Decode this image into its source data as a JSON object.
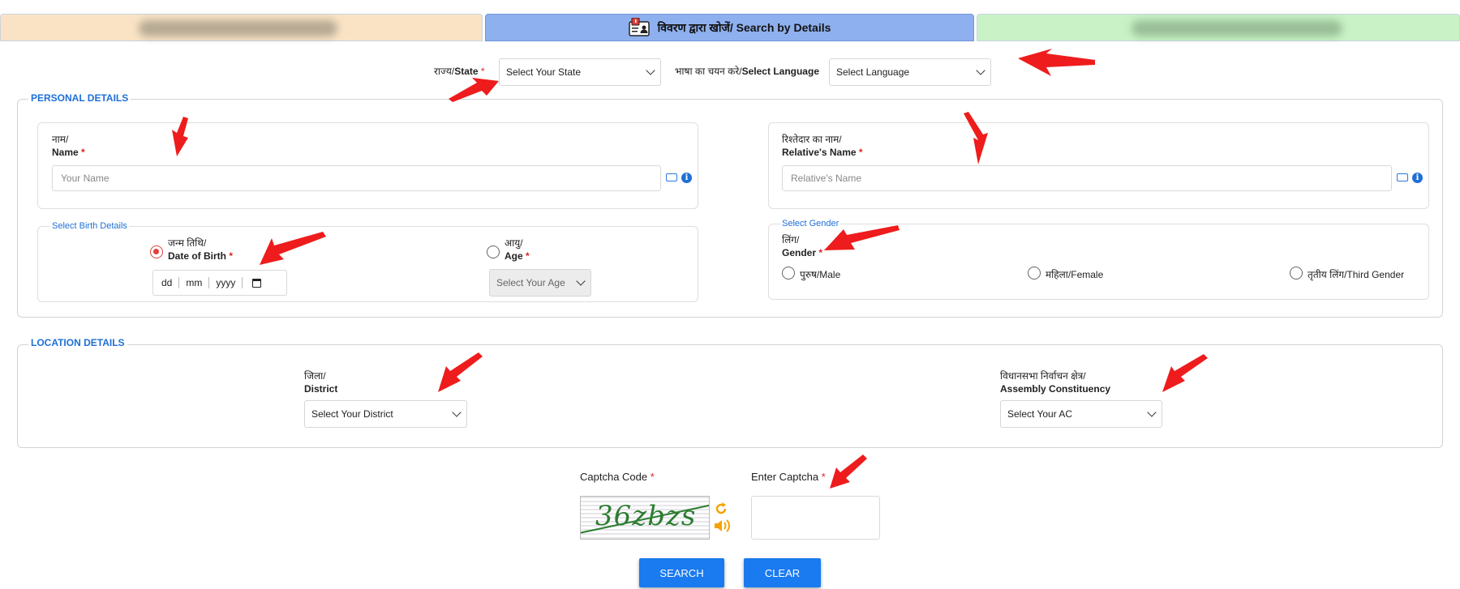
{
  "tabs": {
    "active_label": "विवरण द्वारा खोजें/ Search by Details"
  },
  "top": {
    "state_label_hi": "राज्य/",
    "state_label_en": "State",
    "state_select": "Select Your State",
    "language_label_hi": "भाषा का चयन करे/",
    "language_label_en": "Select Language",
    "language_select": "Select Language"
  },
  "personal": {
    "legend": "PERSONAL DETAILS",
    "name_hi": "नाम/",
    "name_en": "Name",
    "name_placeholder": "Your Name",
    "relative_hi": "रिश्तेदार का नाम/",
    "relative_en": "Relative's Name",
    "relative_placeholder": "Relative's Name",
    "birth_legend": "Select Birth Details",
    "dob_hi": "जन्म तिथि/",
    "dob_en": "Date of Birth",
    "dob_dd": "dd",
    "dob_mm": "mm",
    "dob_yyyy": "yyyy",
    "age_hi": "आयु/",
    "age_en": "Age",
    "age_select": "Select Your Age",
    "gender_legend": "Select Gender",
    "gender_hi": "लिंग/",
    "gender_en": "Gender",
    "gender_male": "पुरुष/Male",
    "gender_female": "महिला/Female",
    "gender_third": "तृतीय लिंग/Third Gender"
  },
  "location": {
    "legend": "LOCATION DETAILS",
    "district_hi": "जिला/",
    "district_en": "District",
    "district_select": "Select Your District",
    "ac_hi": "विधानसभा निर्वाचन क्षेत्र/",
    "ac_en": "Assembly Constituency",
    "ac_select": "Select Your AC"
  },
  "captcha": {
    "code_label": "Captcha Code",
    "enter_label": "Enter Captcha",
    "image_text": "36zbzs",
    "required_mark": "*"
  },
  "buttons": {
    "search": "SEARCH",
    "clear": "CLEAR"
  },
  "colors": {
    "accent": "#1a7af0",
    "legend": "#1f6fd6",
    "annotation_arrow": "#ee1c1c",
    "tab_left": "#fae3c5",
    "tab_active": "#8fb0ee",
    "tab_right": "#c9f3c6"
  }
}
